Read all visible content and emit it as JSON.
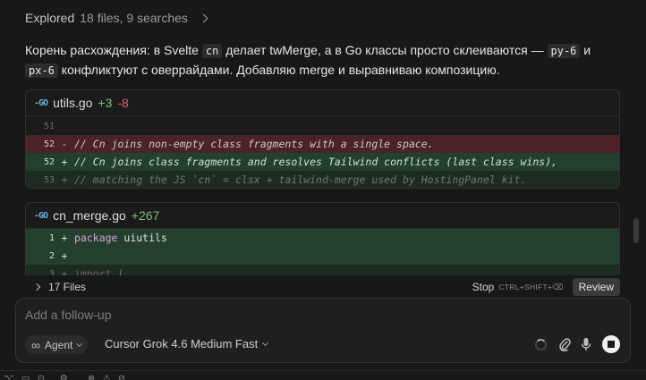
{
  "explored": {
    "label": "Explored",
    "detail": "18 files, 9 searches"
  },
  "message": {
    "part1": "Корень расхождения: в Svelte",
    "code1": "cn",
    "part2": "делает twMerge, а в Go классы просто склеиваются —",
    "code2": "py-6",
    "part3": "и",
    "code3": "px-6",
    "part4": "конфликтуют с оверрайдами. Добавляю merge и выравниваю композицию."
  },
  "diff1": {
    "icon": "go-file-icon",
    "file": "utils.go",
    "added": "+3",
    "removed": "-8",
    "lines": [
      {
        "num": "51",
        "sign": "",
        "text": "",
        "kind": "ctx"
      },
      {
        "num": "52",
        "sign": "-",
        "text": "// Cn joins non-empty class fragments with a single space.",
        "kind": "rem"
      },
      {
        "num": "52",
        "sign": "+",
        "text": "// Cn joins class fragments and resolves Tailwind conflicts (last class wins),",
        "kind": "ins"
      },
      {
        "num": "53",
        "sign": "+",
        "text": "// matching the JS `cn` = clsx + tailwind-merge used by HostingPanel kit.",
        "kind": "ins"
      }
    ]
  },
  "diff2": {
    "icon": "go-file-icon",
    "file": "cn_merge.go",
    "added": "+267",
    "lines": [
      {
        "num": "1",
        "sign": "+",
        "kw": "package",
        "rest": "uiutils"
      },
      {
        "num": "2",
        "sign": "+",
        "kw": "",
        "rest": ""
      },
      {
        "num": "3",
        "sign": "+",
        "kw": "import",
        "rest": "("
      }
    ]
  },
  "files_bar": {
    "label": "17 Files",
    "stop": "Stop",
    "shortcut": "CTRL+SHIFT+⌫",
    "review": "Review"
  },
  "composer": {
    "placeholder": "Add a follow-up",
    "agent": "Agent",
    "model": "Cursor Grok 4.6 Medium Fast"
  },
  "colors": {
    "removed_bg": "#4a2228",
    "added_bg": "#23402e",
    "added_text": "#7fb87f",
    "removed_text": "#e0606a"
  }
}
